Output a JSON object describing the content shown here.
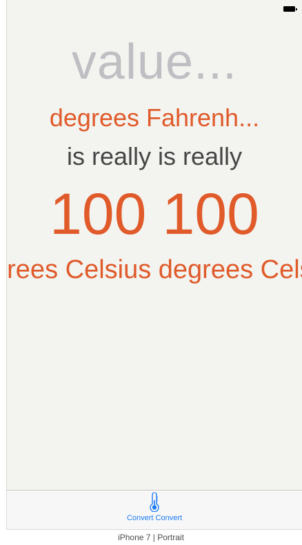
{
  "status_bar": {
    "battery_icon": "battery-full-icon"
  },
  "main": {
    "value_placeholder": "value...",
    "input_unit": "degrees Fahrenh...",
    "connector": "is really is really",
    "result_value": "100 100",
    "result_unit": "degrees Celsius degrees Celsius"
  },
  "tab_bar": {
    "items": [
      {
        "label": "Convert Convert",
        "icon": "thermometer-icon",
        "selected": true
      }
    ],
    "accent_color": "#1e7cf5"
  },
  "caption": "iPhone 7 | Portrait",
  "colors": {
    "accent_orange": "#e05a2a",
    "placeholder_gray": "#bfbfc3",
    "text_dark": "#454545",
    "background": "#f3f3ef"
  }
}
